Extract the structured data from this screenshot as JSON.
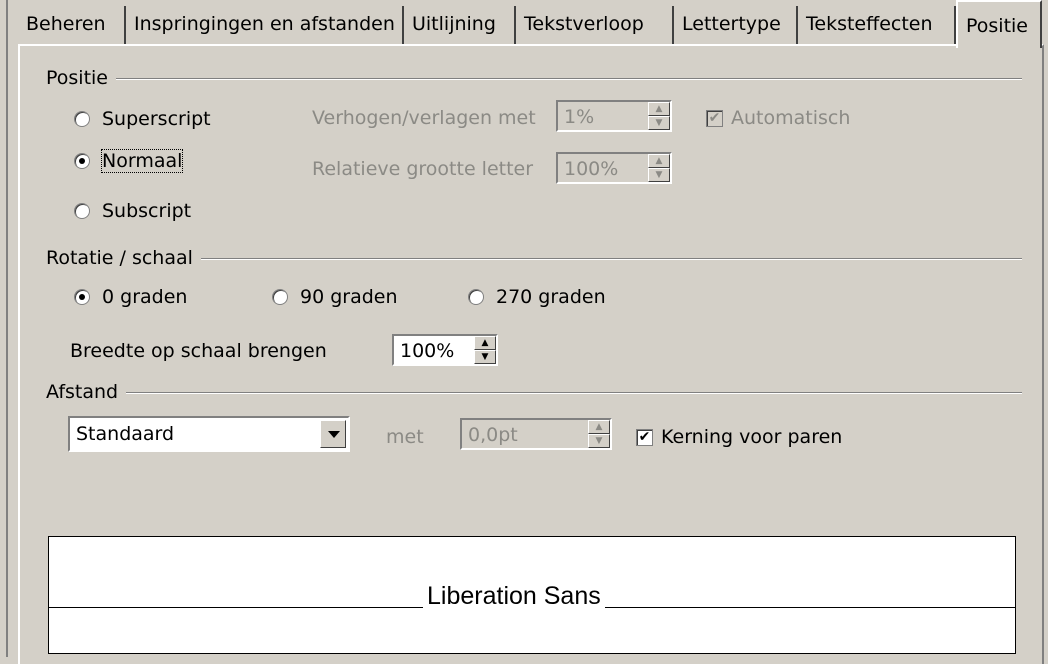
{
  "tabs": [
    "Beheren",
    "Inspringingen en afstanden",
    "Uitlijning",
    "Tekstverloop",
    "Lettertype",
    "Teksteffecten",
    "Positie"
  ],
  "active_tab": "Positie",
  "position": {
    "group_label": "Positie",
    "superscript": "Superscript",
    "normal": "Normaal",
    "subscript": "Subscript",
    "selected": "Normaal",
    "raise_lower_label": "Verhogen/verlagen met",
    "raise_lower_value": "1%",
    "automatic_label": "Automatisch",
    "automatic_checked": true,
    "relative_size_label": "Relatieve grootte letter",
    "relative_size_value": "100%"
  },
  "rotation": {
    "group_label": "Rotatie / schaal",
    "deg0": "0 graden",
    "deg90": "90 graden",
    "deg270": "270 graden",
    "selected": "0 graden",
    "scale_width_label": "Breedte op schaal brengen",
    "scale_width_value": "100%"
  },
  "spacing": {
    "group_label": "Afstand",
    "mode_value": "Standaard",
    "by_label": "met",
    "by_value": "0,0pt",
    "kerning_label": "Kerning voor paren",
    "kerning_checked": true
  },
  "preview": {
    "text": "Liberation Sans"
  },
  "colors": {
    "dialog_bg": "#d4d0c8",
    "disabled_text": "#8b8a85"
  }
}
